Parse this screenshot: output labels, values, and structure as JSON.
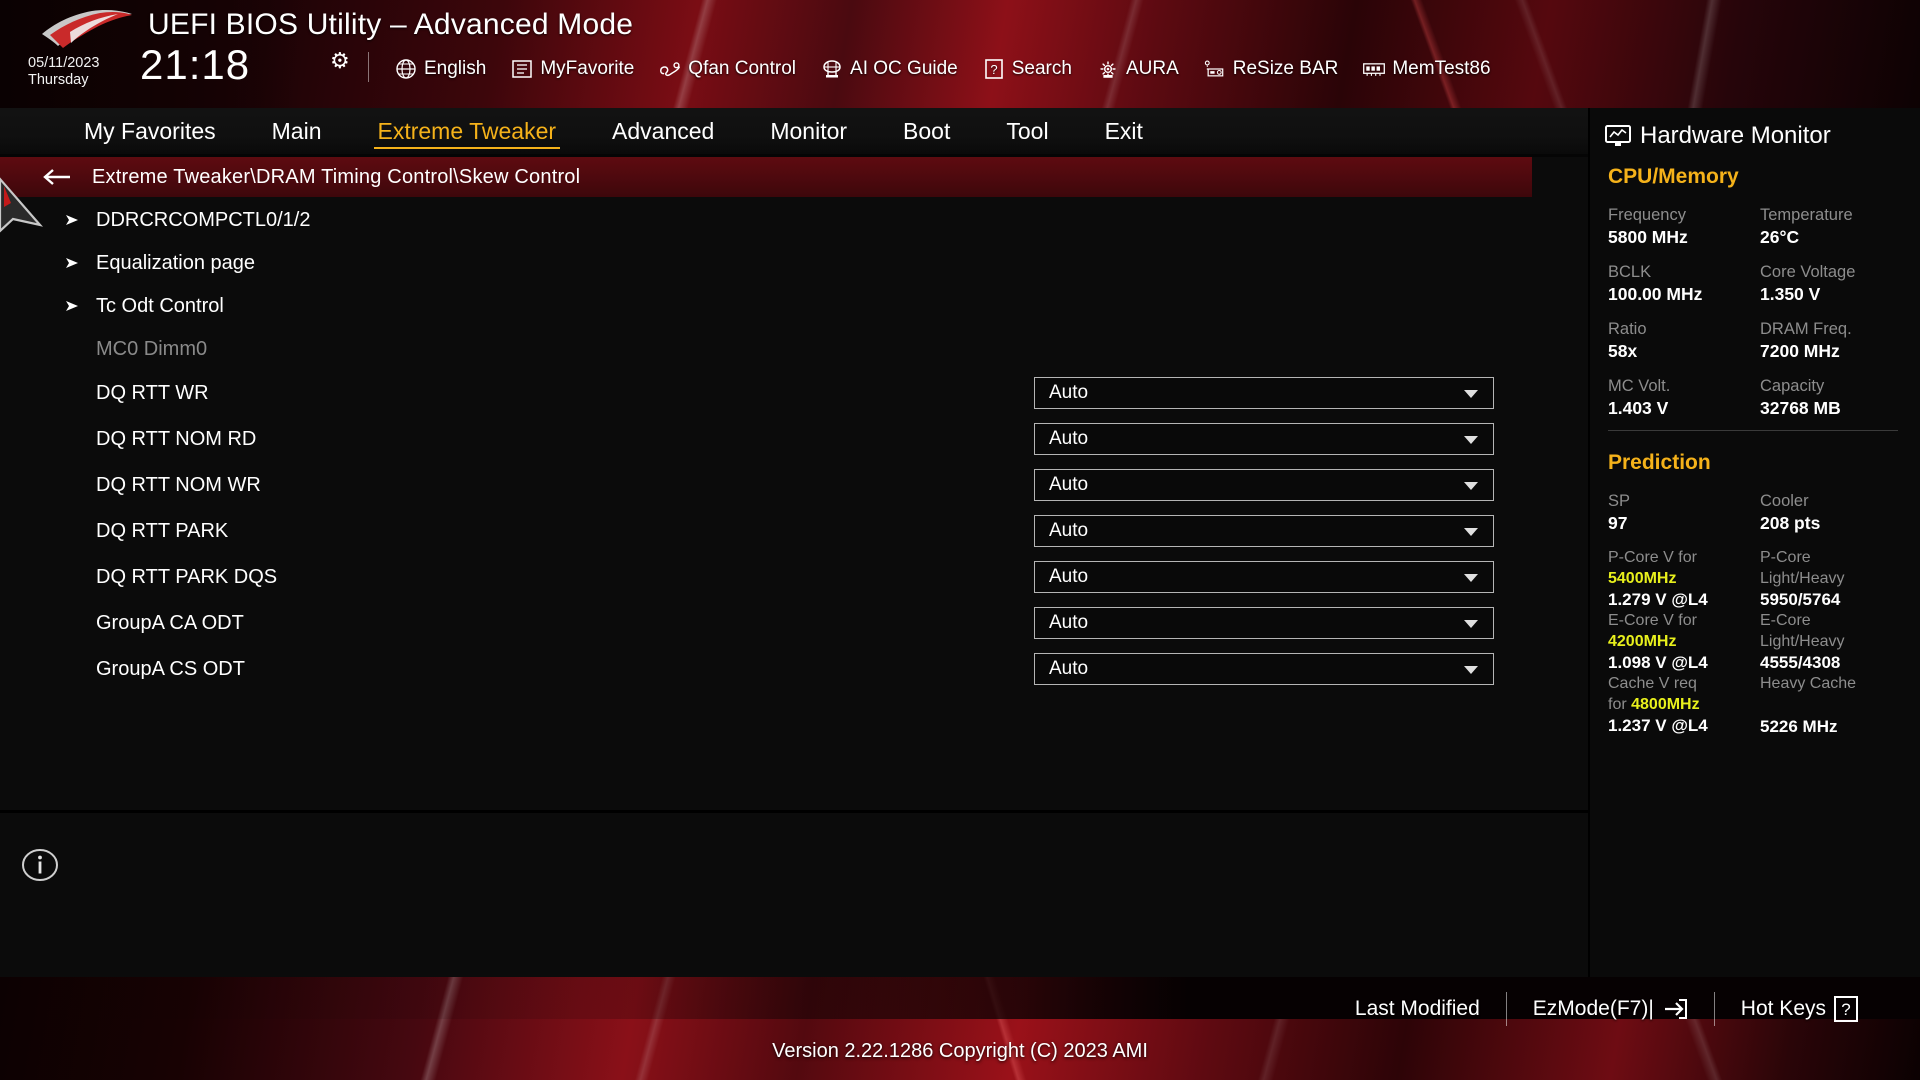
{
  "header": {
    "title": "UEFI BIOS Utility – Advanced Mode",
    "date": "05/11/2023",
    "weekday": "Thursday",
    "time": "21:18",
    "gear_icon": "gear-icon",
    "toolbar": [
      {
        "label": "English",
        "icon": "globe-icon"
      },
      {
        "label": "MyFavorite",
        "icon": "favorites-icon"
      },
      {
        "label": "Qfan Control",
        "icon": "fan-icon"
      },
      {
        "label": "AI OC Guide",
        "icon": "ai-oc-icon"
      },
      {
        "label": "Search",
        "icon": "question-box-icon"
      },
      {
        "label": "AURA",
        "icon": "aura-icon"
      },
      {
        "label": "ReSize BAR",
        "icon": "resize-bar-icon"
      },
      {
        "label": "MemTest86",
        "icon": "memory-module-icon"
      }
    ]
  },
  "nav": {
    "tabs": [
      {
        "label": "My Favorites",
        "active": false
      },
      {
        "label": "Main",
        "active": false
      },
      {
        "label": "Extreme Tweaker",
        "active": true
      },
      {
        "label": "Advanced",
        "active": false
      },
      {
        "label": "Monitor",
        "active": false
      },
      {
        "label": "Boot",
        "active": false
      },
      {
        "label": "Tool",
        "active": false
      },
      {
        "label": "Exit",
        "active": false
      }
    ],
    "active_color": "#f5b21a"
  },
  "breadcrumb": {
    "back_icon": "back-arrow-icon",
    "path": "Extreme Tweaker\\DRAM Timing Control\\Skew Control"
  },
  "menu": {
    "items": [
      {
        "label": "DDRCRCOMPCTL0/1/2",
        "type": "submenu"
      },
      {
        "label": "Equalization page",
        "type": "submenu"
      },
      {
        "label": "Tc Odt Control",
        "type": "submenu"
      },
      {
        "label": "MC0 Dimm0",
        "type": "group-header"
      },
      {
        "label": "DQ RTT WR",
        "type": "dropdown",
        "value": "Auto"
      },
      {
        "label": "DQ RTT NOM RD",
        "type": "dropdown",
        "value": "Auto"
      },
      {
        "label": "DQ RTT NOM WR",
        "type": "dropdown",
        "value": "Auto"
      },
      {
        "label": "DQ RTT PARK",
        "type": "dropdown",
        "value": "Auto"
      },
      {
        "label": "DQ RTT PARK DQS",
        "type": "dropdown",
        "value": "Auto"
      },
      {
        "label": "GroupA CA ODT",
        "type": "dropdown",
        "value": "Auto"
      },
      {
        "label": "GroupA CS ODT",
        "type": "dropdown",
        "value": "Auto"
      }
    ],
    "info_icon": "info-circle-icon"
  },
  "hardware_monitor": {
    "title": "Hardware Monitor",
    "title_icon": "monitor-graph-icon",
    "sections": [
      {
        "name": "CPU/Memory",
        "pairs": [
          [
            {
              "key": "Frequency",
              "value": "5800 MHz"
            },
            {
              "key": "Temperature",
              "value": "26°C"
            }
          ],
          [
            {
              "key": "BCLK",
              "value": "100.00 MHz"
            },
            {
              "key": "Core Voltage",
              "value": "1.350 V"
            }
          ],
          [
            {
              "key": "Ratio",
              "value": "58x"
            },
            {
              "key": "DRAM Freq.",
              "value": "7200 MHz"
            }
          ],
          [
            {
              "key": "MC Volt.",
              "value": "1.403 V"
            },
            {
              "key": "Capacity",
              "value": "32768 MB"
            }
          ]
        ]
      },
      {
        "name": "Prediction",
        "pairs": [
          [
            {
              "key": "SP",
              "value": "97"
            },
            {
              "key": "Cooler",
              "value": "208 pts"
            }
          ]
        ],
        "rows": [
          {
            "left_key_1": "P-Core V for",
            "left_key_2": "5400MHz",
            "left_value": "1.279 V @L4",
            "right_key_1": "P-Core",
            "right_key_2": "Light/Heavy",
            "right_value": "5950/5764"
          },
          {
            "left_key_1": "E-Core V for",
            "left_key_2": "4200MHz",
            "left_value": "1.098 V @L4",
            "right_key_1": "E-Core",
            "right_key_2": "Light/Heavy",
            "right_value": "4555/4308"
          },
          {
            "left_key_1": "Cache V req",
            "left_key_2": "for 4800MHz",
            "left_value": "1.237 V @L4",
            "right_key_1": "Heavy Cache",
            "right_key_2": "",
            "right_value": "5226 MHz"
          }
        ]
      }
    ],
    "accent_color": "#f5b21a",
    "highlight_color": "#e8f01c"
  },
  "footer": {
    "buttons": [
      {
        "label": "Last Modified",
        "icon": ""
      },
      {
        "label": "EzMode(F7)|",
        "icon": "exit-arrow-icon"
      },
      {
        "label": "Hot Keys",
        "icon": "question-box-icon"
      }
    ],
    "version": "Version 2.22.1286 Copyright (C) 2023 AMI"
  }
}
